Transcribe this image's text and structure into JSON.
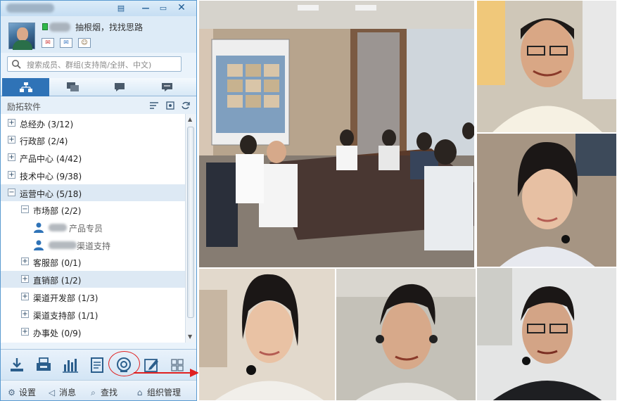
{
  "window": {
    "signature": "抽根烟，找找思路"
  },
  "search": {
    "placeholder": "搜索成员、群组(支持简/全拼、中文)"
  },
  "tabs": [
    {
      "icon": "org-chart-icon",
      "active": true
    },
    {
      "icon": "chat-bubbles-icon",
      "active": false
    },
    {
      "icon": "chat-bubble-icon",
      "active": false
    },
    {
      "icon": "message-icon",
      "active": false
    }
  ],
  "group": {
    "title": "励拓软件"
  },
  "tree": {
    "departments": [
      {
        "label": "总经办 (3/12)",
        "expanded": false
      },
      {
        "label": "行政部 (2/4)",
        "expanded": false
      },
      {
        "label": "产品中心 (4/42)",
        "expanded": false
      },
      {
        "label": "技术中心 (9/38)",
        "expanded": false
      },
      {
        "label": "运营中心 (5/18)",
        "expanded": true,
        "selected": true
      },
      {
        "label": "市场部 (2/2)",
        "expanded": true
      },
      {
        "label": "产品专员",
        "member": true
      },
      {
        "label": "渠道支持",
        "member": true
      },
      {
        "label": "客服部 (0/1)",
        "expanded": false
      },
      {
        "label": "直销部 (1/2)",
        "expanded": false
      },
      {
        "label": "渠道开发部 (1/3)",
        "expanded": false
      },
      {
        "label": "渠道支持部 (1/1)",
        "expanded": false
      },
      {
        "label": "办事处 (0/9)",
        "expanded": false
      }
    ]
  },
  "toolbar": {
    "tools": [
      "download-icon",
      "fax-icon",
      "bar-chart-icon",
      "notes-icon",
      "video-camera-icon",
      "edit-icon",
      "grid-icon"
    ],
    "highlighted": "video-camera-icon",
    "highlight_color": "#e02020"
  },
  "bottombar": {
    "settings": "设置",
    "messages": "消息",
    "search": "查找",
    "org_manage": "组织管理"
  },
  "colors": {
    "accent": "#2f73b7",
    "online": "#2fb84a"
  }
}
